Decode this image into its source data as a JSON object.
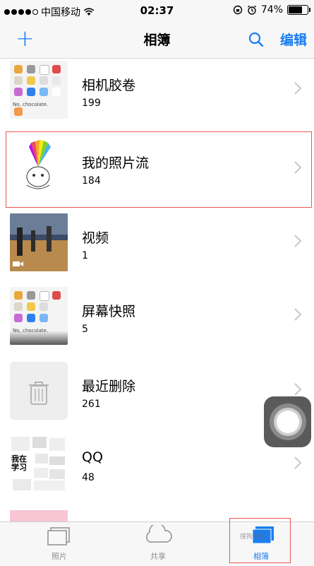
{
  "status_bar": {
    "carrier": "中国移动",
    "time": "02:37",
    "battery": "74%",
    "battery_level": 0.74,
    "signal_bars_filled": 4,
    "signal_bars_total": 5
  },
  "nav": {
    "add_label": "+",
    "title": "相簿",
    "edit_label": "编辑"
  },
  "albums": [
    {
      "name": "相机胶卷",
      "count": "199"
    },
    {
      "name": "我的照片流",
      "count": "184"
    },
    {
      "name": "视频",
      "count": "1"
    },
    {
      "name": "屏幕快照",
      "count": "5"
    },
    {
      "name": "最近删除",
      "count": "261"
    },
    {
      "name": "QQ",
      "count": "48"
    }
  ],
  "thumbs": {
    "no_chocolate": "No, chocolate.",
    "qq_text": "我在学习"
  },
  "tabs": [
    {
      "label": "照片",
      "active": false
    },
    {
      "label": "共享",
      "active": false
    },
    {
      "label": "相簿",
      "active": true
    }
  ],
  "watermark": "搜狗指南",
  "colors": {
    "accent": "#1a7ef0",
    "highlight": "#e55555",
    "separator": "#d8d8d8"
  }
}
